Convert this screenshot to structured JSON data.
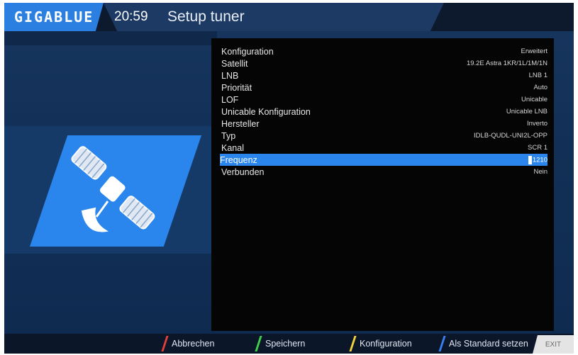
{
  "header": {
    "logo": "GIGABLUE",
    "clock": "20:59",
    "title": "Setup tuner"
  },
  "menu": {
    "items": [
      {
        "label": "Konfiguration",
        "value": "Erweitert"
      },
      {
        "label": "Satellit",
        "value": "19.2E Astra 1KR/1L/1M/1N"
      },
      {
        "label": "LNB",
        "value": "LNB 1"
      },
      {
        "label": "Priorität",
        "value": "Auto"
      },
      {
        "label": "LOF",
        "value": "Unicable"
      },
      {
        "label": "Unicable Konfiguration",
        "value": "Unicable LNB"
      },
      {
        "label": "Hersteller",
        "value": "Inverto"
      },
      {
        "label": "Typ",
        "value": "IDLB-QUDL-UNI2L-OPP"
      },
      {
        "label": "Kanal",
        "value": "SCR 1"
      },
      {
        "label": "Frequenz",
        "value": "1210"
      },
      {
        "label": "Verbunden",
        "value": "Nein"
      }
    ],
    "selected_index": 9
  },
  "footer": {
    "red": "Abbrechen",
    "green": "Speichern",
    "yellow": "Konfiguration",
    "blue": "Als Standard setzen",
    "exit": "EXIT"
  },
  "colors": {
    "accent": "#2a86ec",
    "red": "#e0403a",
    "green": "#3fd04a",
    "yellow": "#f2d23a",
    "blue": "#3a7ef0"
  },
  "icons": {
    "panel": "satellite-icon"
  }
}
